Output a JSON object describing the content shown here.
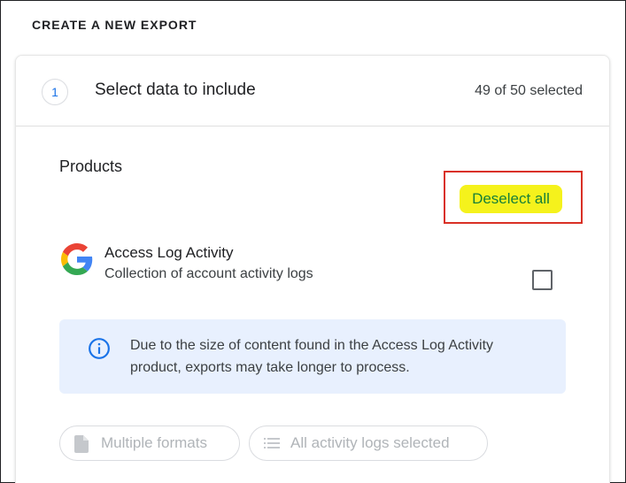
{
  "section_heading": "CREATE A NEW EXPORT",
  "step": {
    "number": "1",
    "title": "Select data to include",
    "selected_count": "49 of 50 selected"
  },
  "products": {
    "label": "Products",
    "deselect_all_label": "Deselect all"
  },
  "product_item": {
    "icon": "google-logo-icon",
    "name": "Access Log Activity",
    "description": "Collection of account activity logs",
    "checked": false
  },
  "info": {
    "icon": "info-icon",
    "text": "Due to the size of content found in the Access Log Activity product, exports may take longer to process."
  },
  "chips": {
    "formats": {
      "icon": "file-icon",
      "label": "Multiple formats"
    },
    "activity": {
      "icon": "list-icon",
      "label": "All activity logs selected"
    }
  },
  "colors": {
    "accent_blue": "#1a73e8",
    "green_text": "#188038",
    "highlight_yellow": "#f5f21c",
    "annotation_red": "#d93025",
    "info_background": "#e8f0fe"
  }
}
